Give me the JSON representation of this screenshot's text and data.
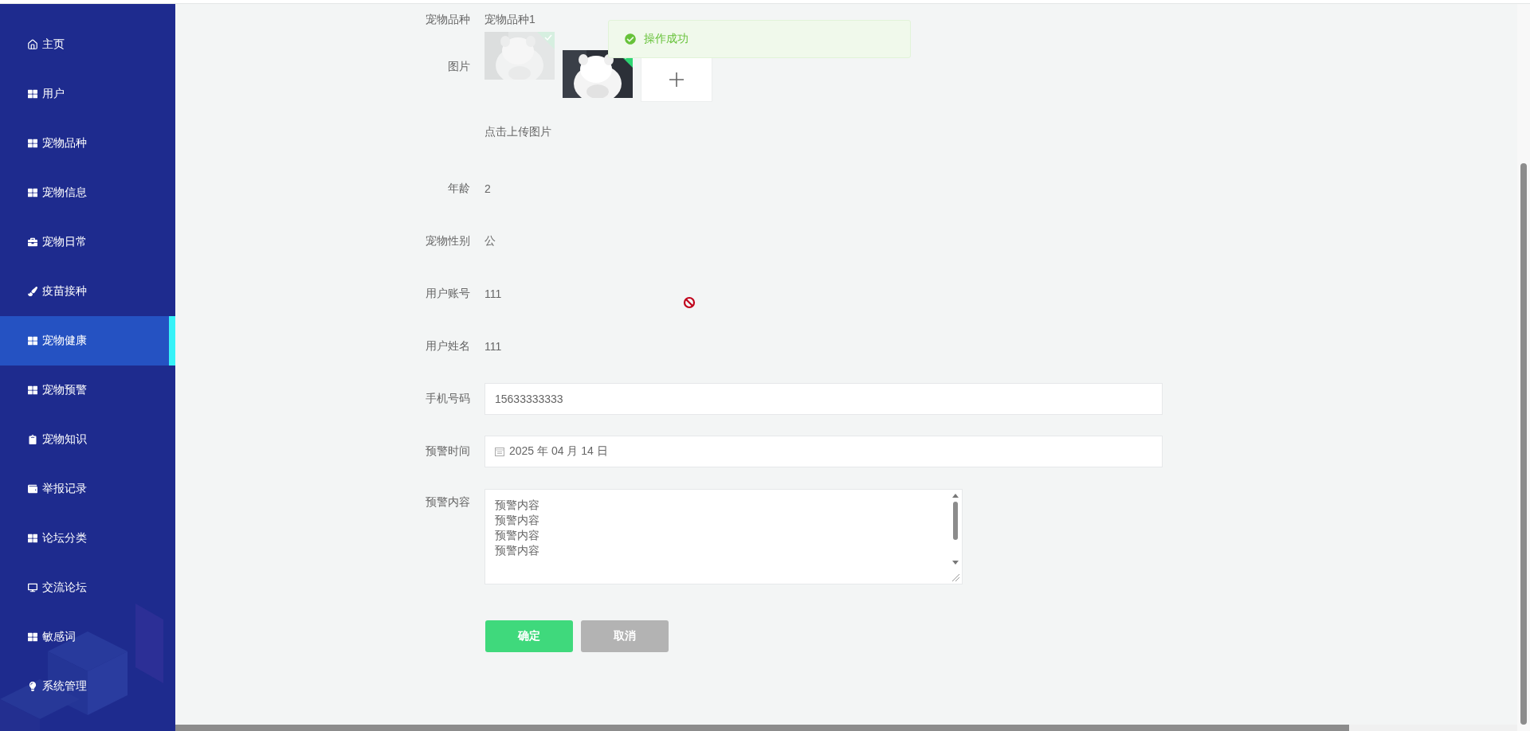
{
  "sidebar": {
    "items": [
      {
        "label": "主页",
        "kind": "home",
        "selected": false
      },
      {
        "label": "用户",
        "kind": "grid",
        "selected": false
      },
      {
        "label": "宠物品种",
        "kind": "grid",
        "selected": false
      },
      {
        "label": "宠物信息",
        "kind": "grid",
        "selected": false
      },
      {
        "label": "宠物日常",
        "kind": "briefcase",
        "selected": false
      },
      {
        "label": "疫苗接种",
        "kind": "brush",
        "selected": false
      },
      {
        "label": "宠物健康",
        "kind": "grid",
        "selected": true
      },
      {
        "label": "宠物预警",
        "kind": "grid",
        "selected": false
      },
      {
        "label": "宠物知识",
        "kind": "clipboard",
        "selected": false
      },
      {
        "label": "举报记录",
        "kind": "wallet",
        "selected": false
      },
      {
        "label": "论坛分类",
        "kind": "grid",
        "selected": false
      },
      {
        "label": "交流论坛",
        "kind": "monitor",
        "selected": false
      },
      {
        "label": "敏感词",
        "kind": "grid",
        "selected": false
      },
      {
        "label": "系统管理",
        "kind": "bulb",
        "selected": false
      }
    ]
  },
  "form": {
    "rows": [
      {
        "kind": "text",
        "label": "宠物品种",
        "value": "宠物品种1"
      },
      {
        "kind": "images",
        "label": "图片",
        "images": [
          {
            "kind": "picture",
            "faded": true
          },
          {
            "kind": "picture",
            "faded": false
          }
        ]
      },
      {
        "kind": "hint",
        "value": "点击上传图片"
      },
      {
        "kind": "text",
        "label": "年龄",
        "value": "2"
      },
      {
        "kind": "text",
        "label": "宠物性别",
        "value": "公"
      },
      {
        "kind": "text",
        "label": "用户账号",
        "value": "111"
      },
      {
        "kind": "text",
        "label": "用户姓名",
        "value": "111"
      },
      {
        "kind": "input",
        "label": "手机号码",
        "value": "15633333333"
      },
      {
        "kind": "date",
        "label": "预警时间",
        "value": "2025 年 04 月 14 日"
      },
      {
        "kind": "textarea",
        "label": "预警内容",
        "lines": [
          "预警内容",
          "预警内容",
          "预警内容",
          "预警内容"
        ]
      }
    ],
    "buttons": [
      {
        "label": "确定",
        "kind": "primary"
      },
      {
        "label": "取消",
        "kind": "cancel"
      }
    ]
  },
  "toast": {
    "kind": "success",
    "message": "操作成功"
  }
}
